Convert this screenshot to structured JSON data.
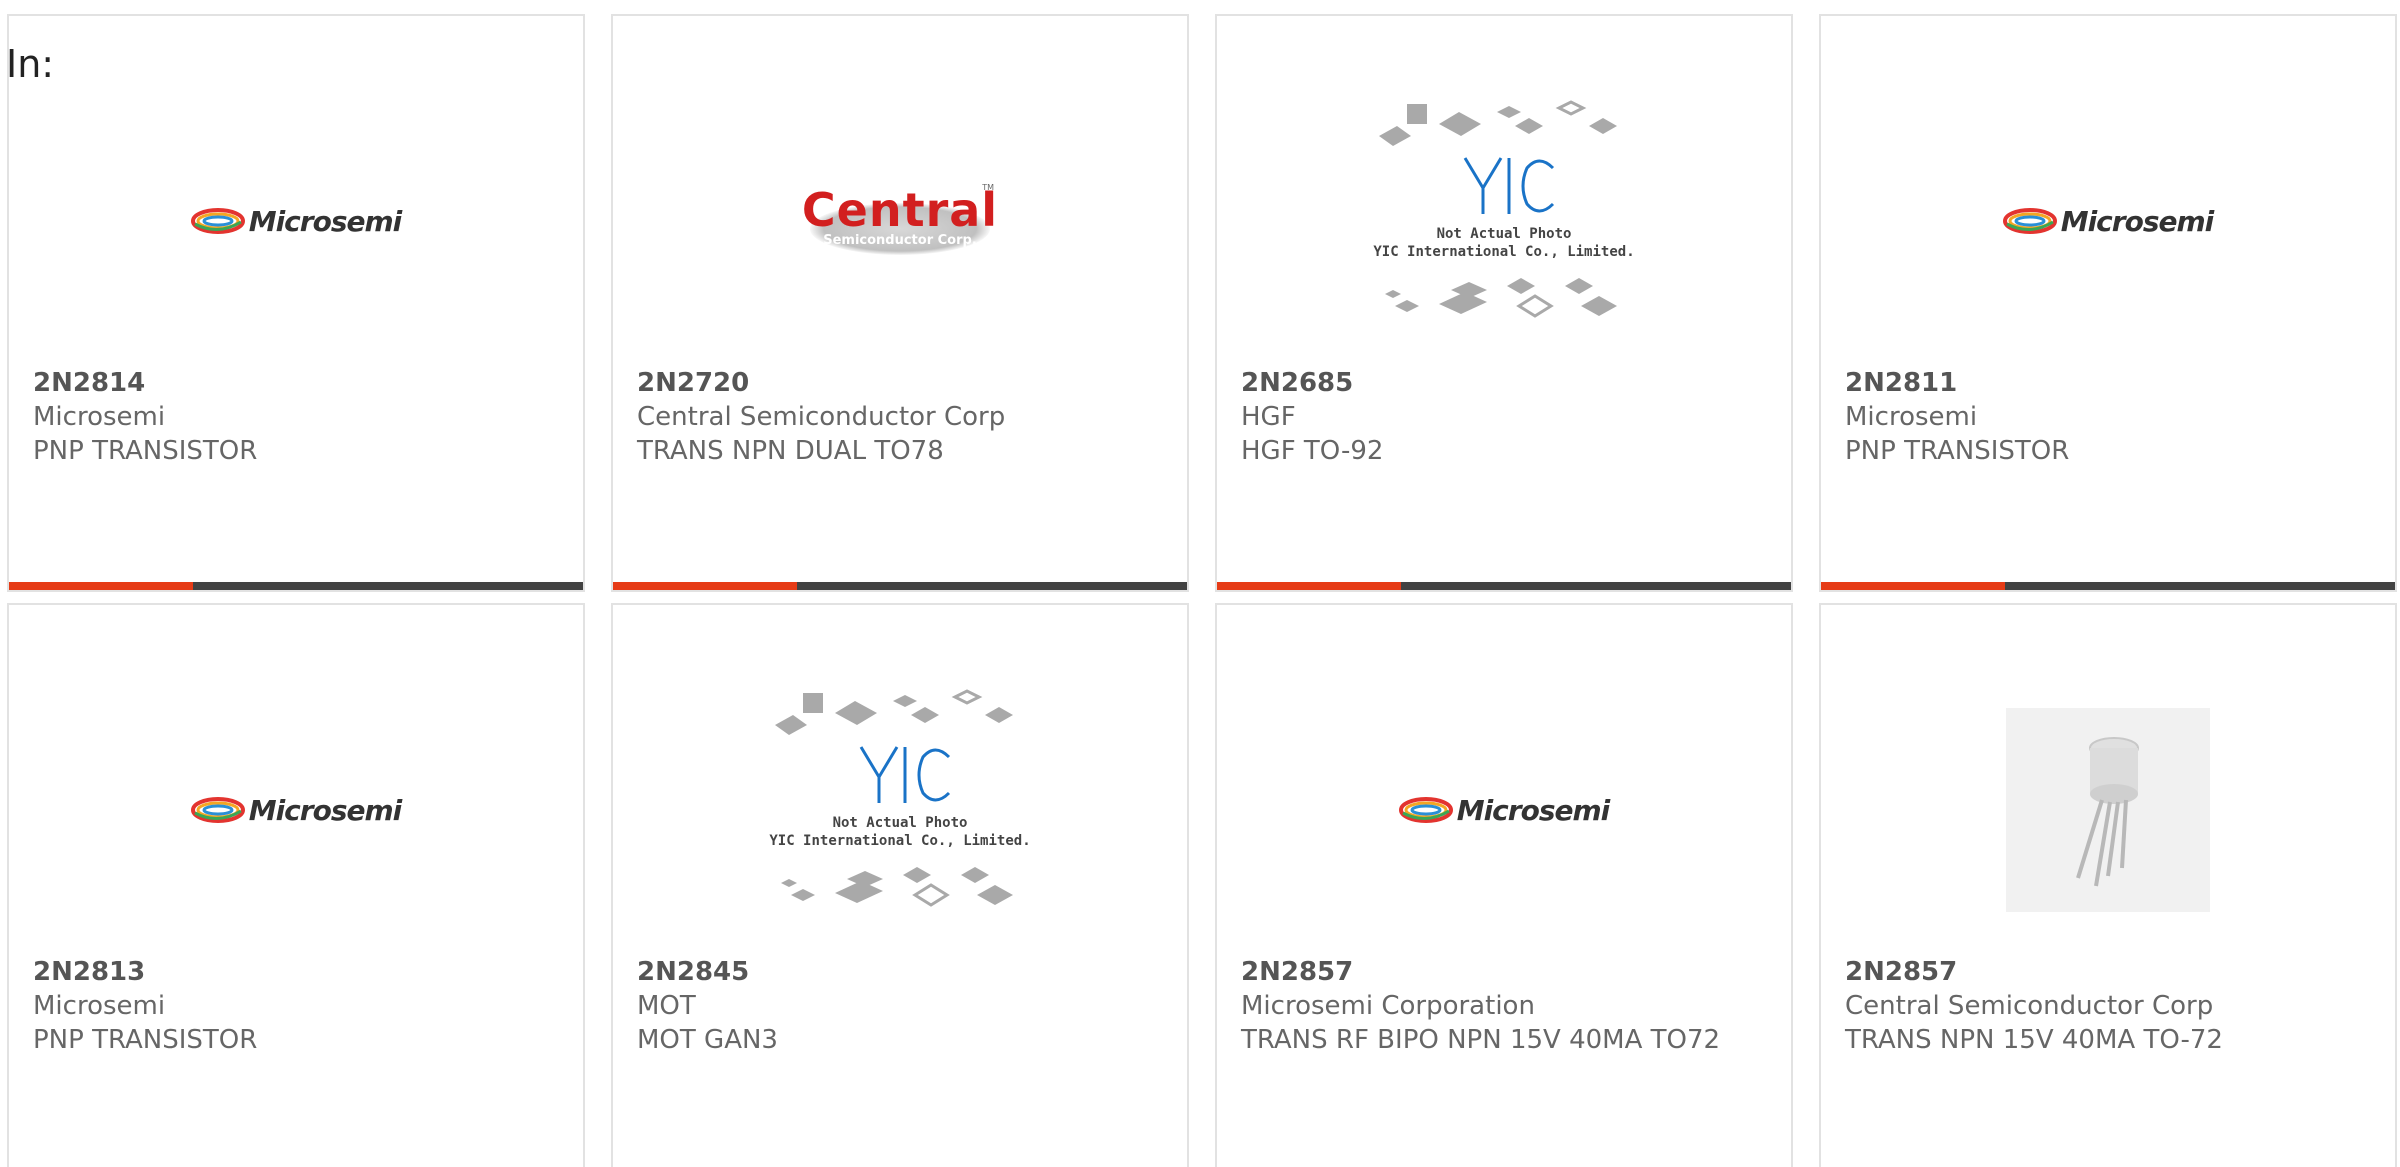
{
  "header": {
    "in_label": "In:"
  },
  "colors": {
    "accent": "#e63b16",
    "bar": "#424242",
    "border": "#e2e2e2"
  },
  "cards": [
    {
      "part": "2N2814",
      "manufacturer": "Microsemi",
      "description": "PNP TRANSISTOR",
      "image": "microsemi-logo",
      "logo_text": "Microsemi"
    },
    {
      "part": "2N2720",
      "manufacturer": "Central Semiconductor Corp",
      "description": "TRANS NPN DUAL TO78",
      "image": "central-logo",
      "logo_text": "Central",
      "logo_sub": "Semiconductor Corp.",
      "logo_tm": "TM"
    },
    {
      "part": "2N2685",
      "manufacturer": "HGF",
      "description": "HGF TO-92",
      "image": "yic-placeholder",
      "logo_line1": "Not Actual Photo",
      "logo_line2": "YIC International Co., Limited."
    },
    {
      "part": "2N2811",
      "manufacturer": "Microsemi",
      "description": "PNP TRANSISTOR",
      "image": "microsemi-logo",
      "logo_text": "Microsemi"
    },
    {
      "part": "2N2813",
      "manufacturer": "Microsemi",
      "description": "PNP TRANSISTOR",
      "image": "microsemi-logo",
      "logo_text": "Microsemi"
    },
    {
      "part": "2N2845",
      "manufacturer": "MOT",
      "description": "MOT GAN3",
      "image": "yic-placeholder",
      "logo_line1": "Not Actual Photo",
      "logo_line2": "YIC International Co., Limited."
    },
    {
      "part": "2N2857",
      "manufacturer": "Microsemi Corporation",
      "description": "TRANS RF BIPO NPN 15V 40MA TO72",
      "image": "microsemi-logo",
      "logo_text": "Microsemi"
    },
    {
      "part": "2N2857",
      "manufacturer": "Central Semiconductor Corp",
      "description": "TRANS NPN 15V 40MA TO-72",
      "image": "transistor-photo"
    }
  ]
}
